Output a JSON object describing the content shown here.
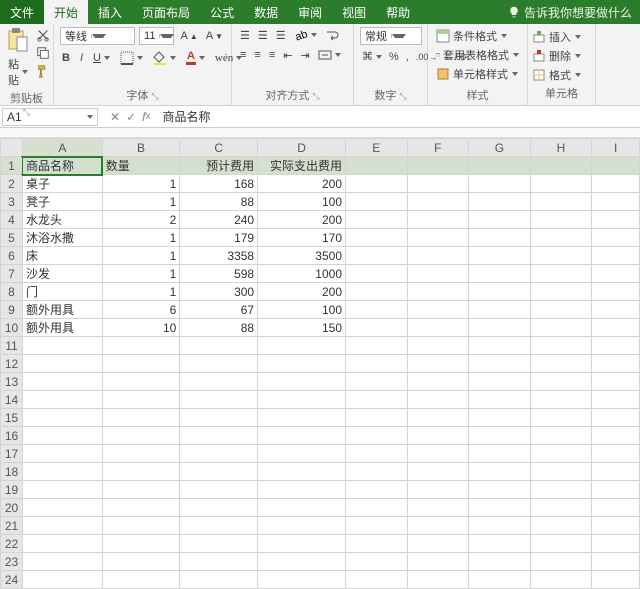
{
  "tabs": {
    "file": "文件",
    "home": "开始",
    "insert": "插入",
    "layout": "页面布局",
    "formula": "公式",
    "data": "数据",
    "review": "审阅",
    "view": "视图",
    "help": "帮助",
    "tell": "告诉我你想要做什么"
  },
  "ribbon": {
    "clipboard": {
      "label": "剪贴板",
      "paste": "粘贴"
    },
    "font": {
      "label": "字体",
      "name": "等线",
      "size": "11",
      "bold": "B",
      "italic": "I",
      "underline": "U"
    },
    "align": {
      "label": "对齐方式"
    },
    "number": {
      "label": "数字",
      "format": "常规"
    },
    "styles": {
      "label": "样式",
      "cond": "条件格式",
      "tbl": "套用표格格式",
      "cell": "单元格样式"
    },
    "styles_cn": {
      "cond": "条件格式",
      "tbl": "套用表格格式",
      "cell": "单元格样式"
    },
    "cells": {
      "label": "单元格",
      "insert": "插入",
      "delete": "删除",
      "format": "格式"
    }
  },
  "formula_bar": {
    "cellref": "A1",
    "value": "商品名称"
  },
  "columns": [
    "A",
    "B",
    "C",
    "D",
    "E",
    "F",
    "G",
    "H",
    "I"
  ],
  "headers": {
    "a": "商品名称",
    "b": "数量",
    "c": "预计费用",
    "d": "实际支出费用"
  },
  "rows": [
    {
      "a": "桌子",
      "b": 1,
      "c": 168,
      "d": 200
    },
    {
      "a": "凳子",
      "b": 1,
      "c": 88,
      "d": 100
    },
    {
      "a": "水龙头",
      "b": 2,
      "c": 240,
      "d": 200
    },
    {
      "a": "沐浴水撒",
      "b": 1,
      "c": 179,
      "d": 170
    },
    {
      "a": "床",
      "b": 1,
      "c": 3358,
      "d": 3500
    },
    {
      "a": "沙发",
      "b": 1,
      "c": 598,
      "d": 1000
    },
    {
      "a": "门",
      "b": 1,
      "c": 300,
      "d": 200
    },
    {
      "a": "额外用具",
      "b": 6,
      "c": 67,
      "d": 100
    },
    {
      "a": "额外用具",
      "b": 10,
      "c": 88,
      "d": 150
    }
  ],
  "chart_data": {
    "type": "table",
    "columns": [
      "商品名称",
      "数量",
      "预计费用",
      "实际支出费用"
    ],
    "data": [
      [
        "桌子",
        1,
        168,
        200
      ],
      [
        "凳子",
        1,
        88,
        100
      ],
      [
        "水龙头",
        2,
        240,
        200
      ],
      [
        "沐浴水撒",
        1,
        179,
        170
      ],
      [
        "床",
        1,
        3358,
        3500
      ],
      [
        "沙发",
        1,
        598,
        1000
      ],
      [
        "门",
        1,
        300,
        200
      ],
      [
        "额外用具",
        6,
        67,
        100
      ],
      [
        "额外用具",
        10,
        88,
        150
      ]
    ]
  }
}
